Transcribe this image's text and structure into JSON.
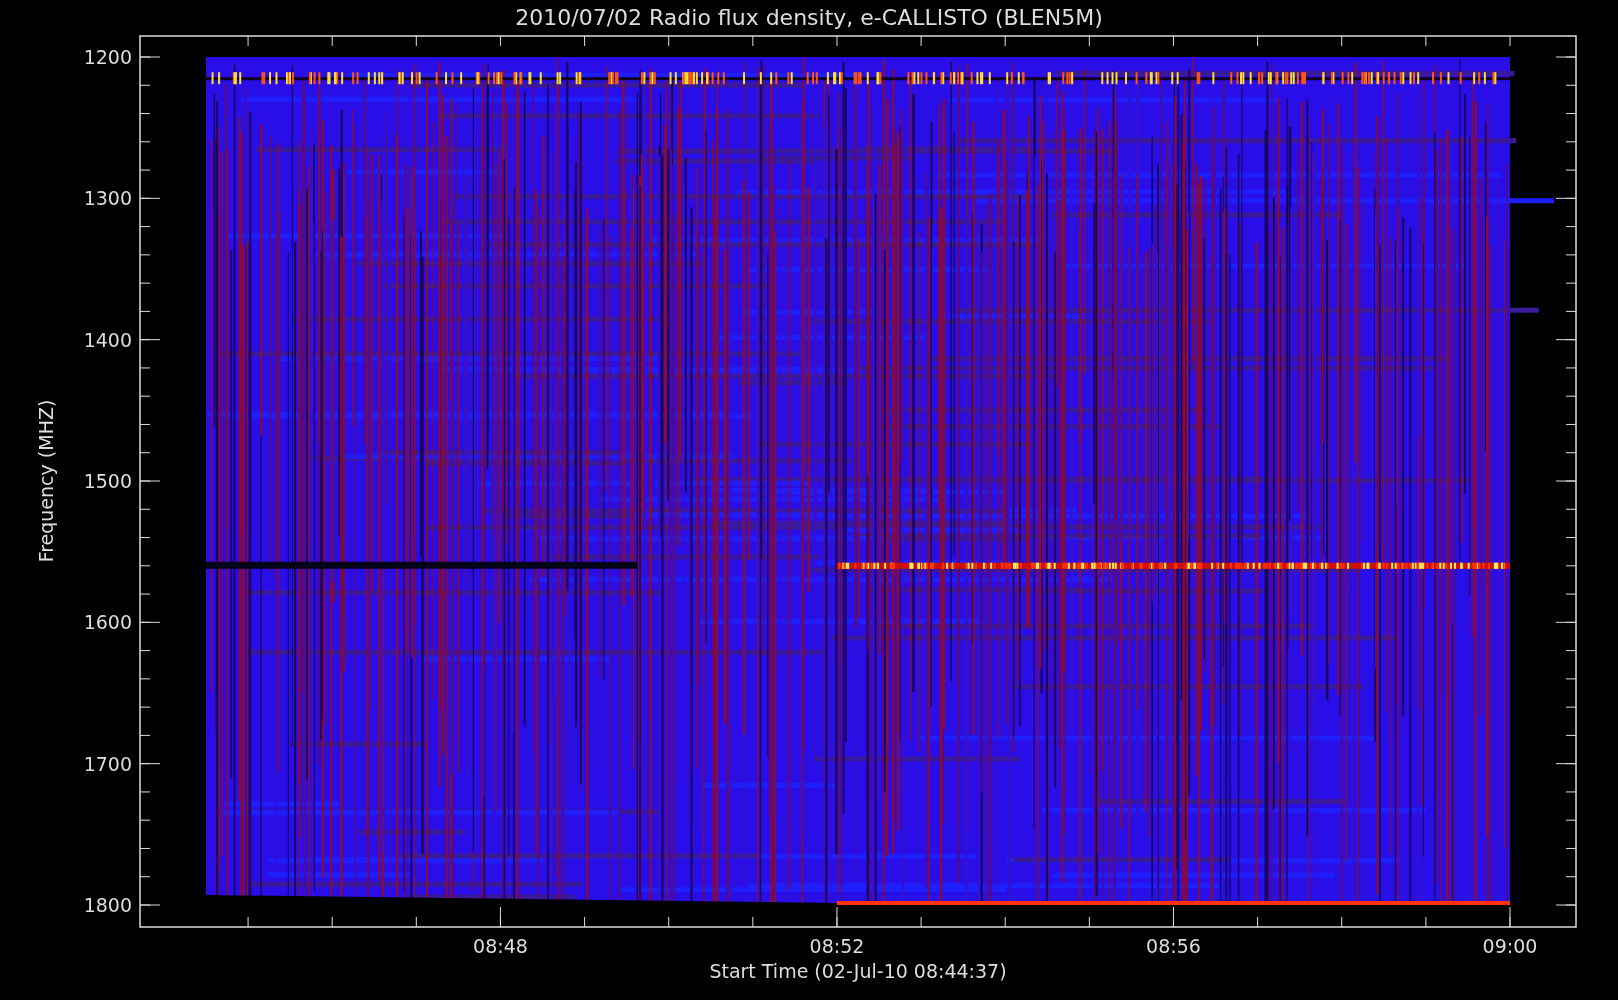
{
  "title": "2010/07/02  Radio flux density, e-CALLISTO (BLEN5M)",
  "y_axis": {
    "label": "Frequency (MHZ)",
    "ticks": [
      "1200",
      "1300",
      "1400",
      "1500",
      "1600",
      "1700",
      "1800"
    ]
  },
  "x_axis": {
    "label": "Start Time (02-Jul-10 08:44:37)",
    "ticks": [
      "08:48",
      "08:52",
      "08:56",
      "09:00"
    ]
  }
}
